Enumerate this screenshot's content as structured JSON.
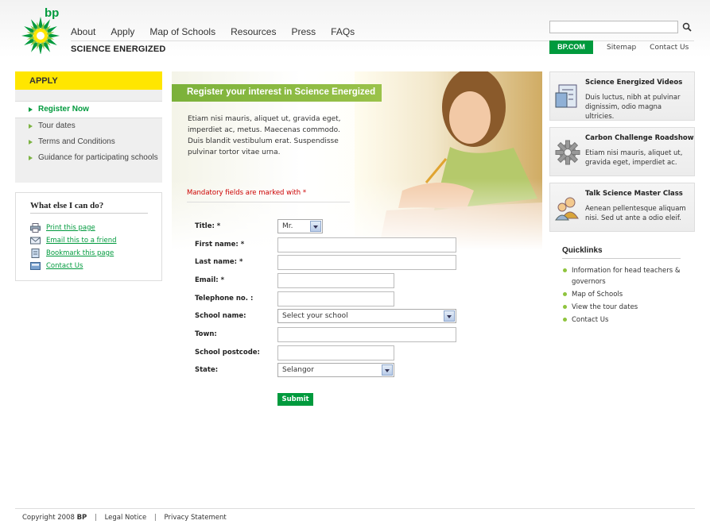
{
  "logo": {
    "text": "bp",
    "alt": "BP Helios logo"
  },
  "nav": {
    "items": [
      "About",
      "Apply",
      "Map of Schools",
      "Resources",
      "Press",
      "FAQs"
    ]
  },
  "tagline": "SCIENCE ENERGIZED",
  "search": {
    "placeholder": "",
    "icon": "search-icon"
  },
  "top_links": {
    "bpcom": "BP.COM",
    "sitemap": "Sitemap",
    "contact": "Contact Us"
  },
  "apply": {
    "heading": "APPLY",
    "items": [
      "Register Now",
      "Tour dates",
      "Terms and Conditions",
      "Guidance for participating schools"
    ]
  },
  "whatelse": {
    "heading": "What else I can do?",
    "items": [
      "Print this page",
      "Email this to a friend",
      "Bookmark this page",
      "Contact Us"
    ]
  },
  "hero": {
    "title": "Register your interest in Science Energized",
    "intro": "Etiam nisi mauris, aliquet ut, gravida eget, imperdiet ac, metus. Maecenas commodo. Duis blandit vestibulum erat. Suspendisse pulvinar tortor vitae urna.",
    "mandatory": "Mandatory fields are marked with *"
  },
  "form": {
    "title_label": "Title: *",
    "title_value": "Mr.",
    "first_name_label": "First name: *",
    "last_name_label": "Last name: *",
    "email_label": "Email: *",
    "telephone_label": "Telephone no. :",
    "school_label": "School name:",
    "school_value": "Select your school",
    "town_label": "Town:",
    "postcode_label": "School postcode:",
    "state_label": "State:",
    "state_value": "Selangor",
    "submit_label": "Submit"
  },
  "promos": [
    {
      "title": "Science Energized Videos",
      "body": "Duis luctus, nibh at pulvinar dignissim, odio magna ultricies."
    },
    {
      "title": "Carbon Challenge Roadshow",
      "body": "Etiam nisi mauris, aliquet ut, gravida eget, imperdiet ac."
    },
    {
      "title": "Talk Science Master Class",
      "body": "Aenean pellentesque aliquam nisi. Sed ut ante a odio eleif."
    }
  ],
  "quicklinks": {
    "heading": "Quicklinks",
    "items": [
      "Information for head teachers & governors",
      "Map of Schools",
      "View the tour dates",
      "Contact Us"
    ]
  },
  "footer": {
    "copyright_prefix": "Copyright 2008",
    "copyright_brand": "BP",
    "legal": "Legal Notice",
    "privacy": "Privacy Statement"
  },
  "colors": {
    "brand_green": "#009a3d",
    "brand_yellow": "#ffe600",
    "accent_green": "#7bb13a"
  }
}
